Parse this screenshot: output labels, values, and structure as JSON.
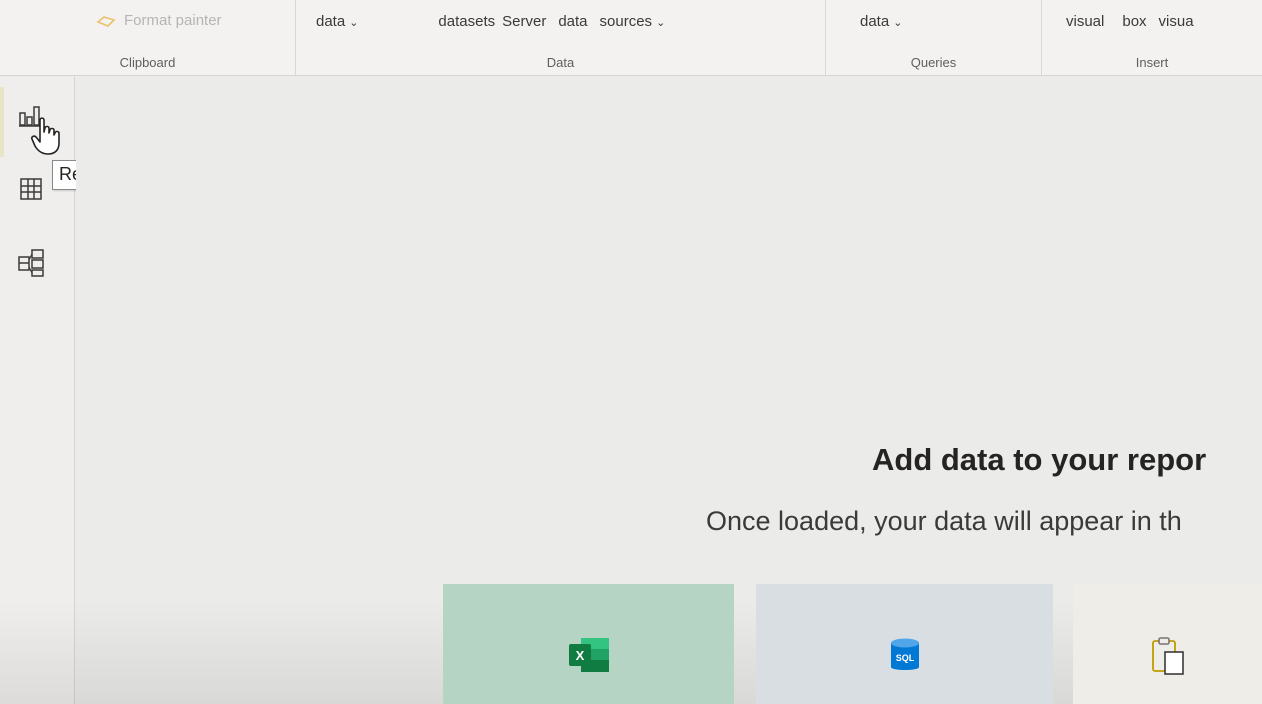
{
  "ribbon": {
    "clipboard": {
      "format_painter": "Format painter",
      "caption": "Clipboard"
    },
    "data": {
      "get_data": "data",
      "datasets": "datasets",
      "server": "Server",
      "data_word": "data",
      "sources": "sources",
      "caption": "Data"
    },
    "queries": {
      "transform_data": "data",
      "caption": "Queries"
    },
    "insert": {
      "visual": "visual",
      "box": "box",
      "visual_cut": "visua",
      "caption": "Insert"
    }
  },
  "leftnav": {
    "items": [
      {
        "name": "Report",
        "icon": "report-icon",
        "active": true
      },
      {
        "name": "Data",
        "icon": "table-icon"
      },
      {
        "name": "Model",
        "icon": "model-icon"
      }
    ],
    "tooltip": "Report"
  },
  "canvas": {
    "heading": "Add data to your repor",
    "subheading": "Once loaded, your data will appear in th",
    "tiles": [
      {
        "icon": "excel-icon",
        "color": "#b6d4c3"
      },
      {
        "icon": "sql-icon",
        "label": "SQL",
        "color": "#d9dee3"
      },
      {
        "icon": "paste-icon",
        "color": "#eeede8"
      }
    ]
  },
  "colors": {
    "excel_green": "#107c41",
    "sql_blue": "#0078d4",
    "paste_gold": "#c19c00"
  }
}
